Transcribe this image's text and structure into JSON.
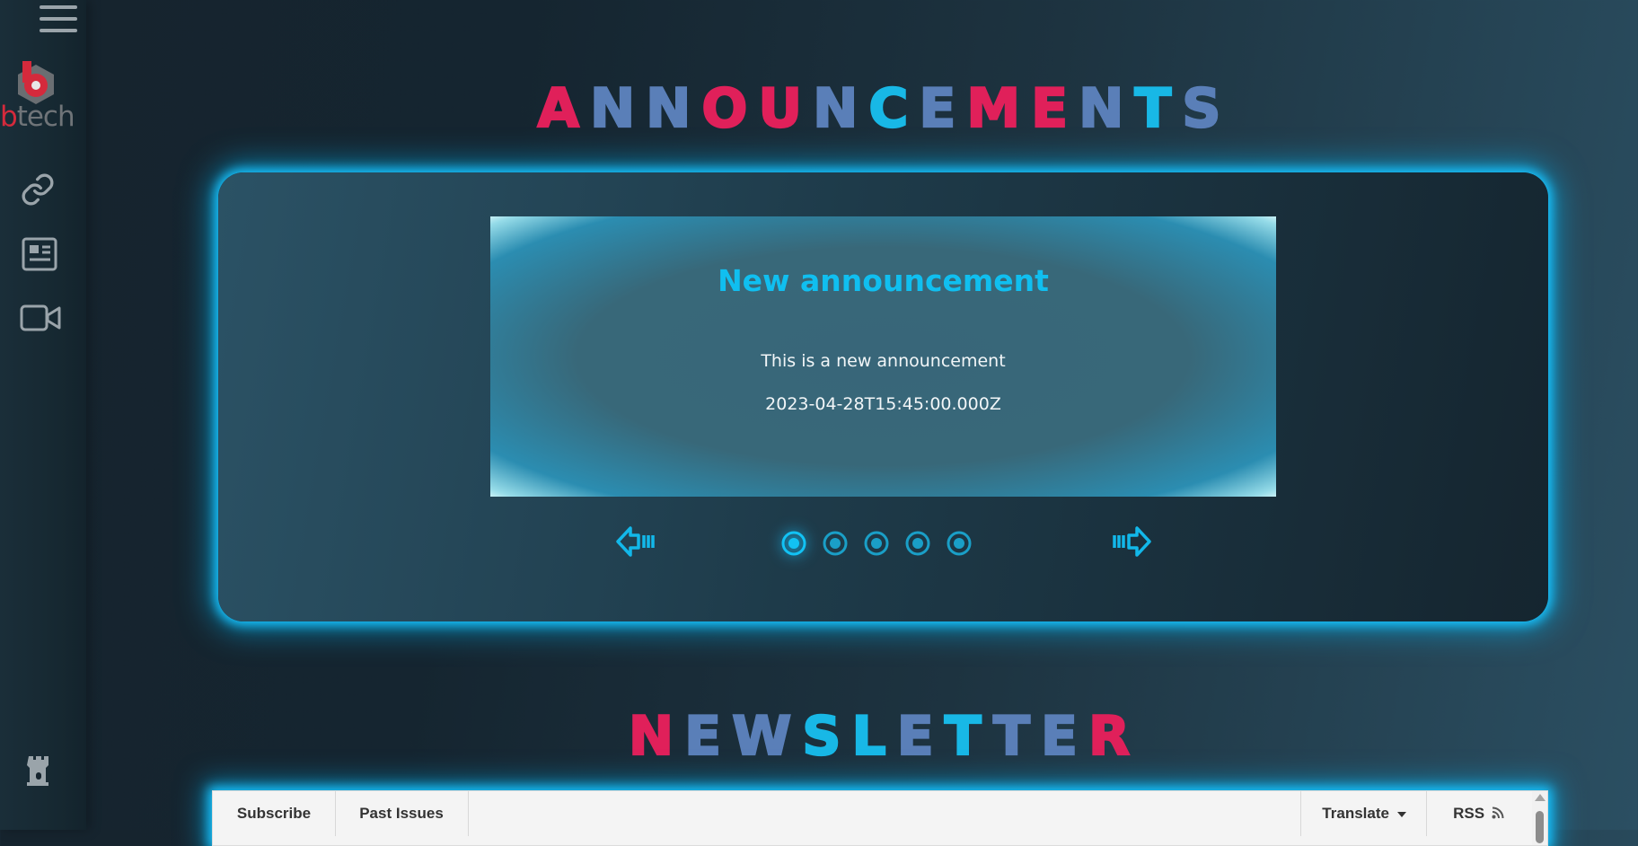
{
  "sidebar": {
    "logo_b": "b",
    "logo_rest": "tech",
    "icons": [
      "menu-icon",
      "link-icon",
      "newspaper-icon",
      "video-icon",
      "castle-tower-icon"
    ]
  },
  "announcements": {
    "title": "ANNOUNCEMENTS",
    "card": {
      "heading": "New announcement",
      "body": "This is a new announcement",
      "date": "2023-04-28T15:45:00.000Z"
    },
    "slides": {
      "count": 5,
      "active_index": 0
    }
  },
  "newsletter": {
    "title": "NEWSLETTER",
    "tabs": {
      "subscribe": "Subscribe",
      "past_issues": "Past Issues",
      "translate": "Translate",
      "rss": "RSS"
    }
  },
  "colors": {
    "accent_cyan": "#10bff0",
    "title_gradient": [
      "#e0205a",
      "#5a7fb8",
      "#18b8e6"
    ],
    "logo_red": "#d42a3c"
  }
}
